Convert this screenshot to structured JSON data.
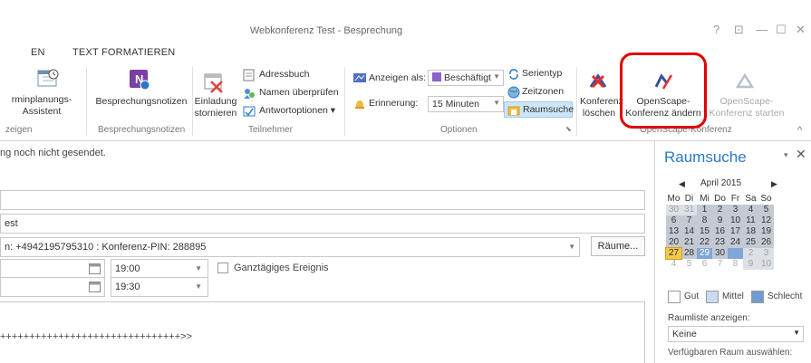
{
  "window": {
    "title": "Webkonferenz Test - Besprechung",
    "controls": [
      "?",
      "⊡",
      "—",
      "☐",
      "✕"
    ]
  },
  "tabs": [
    "EN",
    "TEXT FORMATIEREN"
  ],
  "ribbon": {
    "groups": {
      "anzeigen": "zeigen",
      "notizen": "Besprechungsnotizen",
      "teilnehmer": "Teilnehmer",
      "optionen": "Optionen",
      "openscape": "OpenScape-Konferenz"
    },
    "terminplanung": {
      "line1": "rminplanungs-",
      "line2": "Assistent"
    },
    "besprechungsnotizen": "Besprechungsnotizen",
    "einladung": {
      "line1": "Einladung",
      "line2": "stornieren"
    },
    "adressbuch": "Adressbuch",
    "namen_pruefen": "Namen überprüfen",
    "antwortoptionen": "Antwortoptionen ▾",
    "anzeigen_als": {
      "label": "Anzeigen als:",
      "value": "Beschäftigt"
    },
    "erinnerung": {
      "label": "Erinnerung:",
      "value": "15 Minuten"
    },
    "serientyp": "Serientyp",
    "zeitzonen": "Zeitzonen",
    "raumsuche": "Raumsuche",
    "konferenz_loeschen": {
      "line1": "Konferenz",
      "line2": "löschen"
    },
    "konferenz_aendern": {
      "line1": "OpenScape-",
      "line2": "Konferenz ändern"
    },
    "konferenz_starten": {
      "line1": "OpenScape-",
      "line2": "Konferenz starten"
    },
    "collapse": "^"
  },
  "info_message": "ng noch nicht gesendet.",
  "form": {
    "subject": "",
    "location": "est",
    "dialin": "n: +4942195795310 : Konferenz-PIN: 288895",
    "raeume_button": "Räume...",
    "start_time": "19:00",
    "end_time": "19:30",
    "ganztaegig": "Ganztägiges Ereignis",
    "body_text": "+++++++++++++++++++++++++++++++>>"
  },
  "room_pane": {
    "title": "Raumsuche",
    "month": "April 2015",
    "weekdays": [
      "Mo",
      "Di",
      "Mi",
      "Do",
      "Fr",
      "Sa",
      "So"
    ],
    "weeks": [
      [
        "30",
        "31",
        "1",
        "2",
        "3",
        "4",
        "5"
      ],
      [
        "6",
        "7",
        "8",
        "9",
        "10",
        "11",
        "12"
      ],
      [
        "13",
        "14",
        "15",
        "16",
        "17",
        "18",
        "19"
      ],
      [
        "20",
        "21",
        "22",
        "23",
        "24",
        "25",
        "26"
      ],
      [
        "27",
        "28",
        "29",
        "30",
        "1",
        "2",
        "3"
      ],
      [
        "4",
        "5",
        "6",
        "7",
        "8",
        "9",
        "10"
      ]
    ],
    "legend": {
      "good": "Gut",
      "medium": "Mittel",
      "bad": "Schlecht"
    },
    "raumliste_label": "Raumliste anzeigen:",
    "raumliste_value": "Keine",
    "verfuegbar_label": "Verfügbaren Raum auswählen:"
  },
  "colors": {
    "accent": "#2b79c2",
    "highlight": "#e20000",
    "busy": "#8b62c9"
  }
}
